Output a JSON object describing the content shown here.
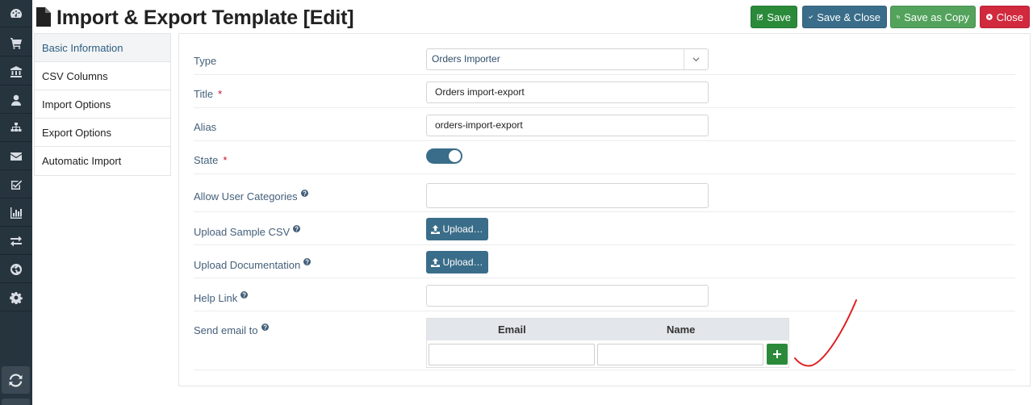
{
  "header": {
    "title": "Import & Export Template [Edit]",
    "buttons": {
      "save": "Save",
      "save_close": "Save & Close",
      "save_copy": "Save as Copy",
      "close": "Close"
    }
  },
  "rail": {
    "icons": [
      "dashboard-icon",
      "cart-icon",
      "bank-icon",
      "user-icon",
      "sitemap-icon",
      "envelope-icon",
      "checkbox-icon",
      "bar-chart-icon",
      "exchange-icon",
      "globe-icon",
      "gear-icon"
    ],
    "bottom_icon": "refresh-icon"
  },
  "tabs": [
    {
      "label": "Basic Information",
      "active": true
    },
    {
      "label": "CSV Columns",
      "active": false
    },
    {
      "label": "Import Options",
      "active": false
    },
    {
      "label": "Export Options",
      "active": false
    },
    {
      "label": "Automatic Import",
      "active": false
    }
  ],
  "form": {
    "type": {
      "label": "Type",
      "value": "Orders Importer"
    },
    "title": {
      "label": "Title",
      "required_mark": "*",
      "value": "Orders import-export"
    },
    "alias": {
      "label": "Alias",
      "value": "orders-import-export"
    },
    "state": {
      "label": "State",
      "required_mark": "*",
      "enabled": true
    },
    "allow_user_categories": {
      "label": "Allow User Categories",
      "value": ""
    },
    "upload_sample_csv": {
      "label": "Upload Sample CSV",
      "button": "Upload…"
    },
    "upload_documentation": {
      "label": "Upload Documentation",
      "button": "Upload…"
    },
    "help_link": {
      "label": "Help Link",
      "value": ""
    },
    "send_email": {
      "label": "Send email to",
      "columns": [
        "Email",
        "Name"
      ],
      "email_value": "",
      "name_value": ""
    }
  },
  "colors": {
    "rail": "#26343e",
    "accent": "#3a6d89",
    "success": "#2a8a3a",
    "copy": "#53a35c",
    "danger": "#d1293d",
    "annotation": "#e02020"
  }
}
